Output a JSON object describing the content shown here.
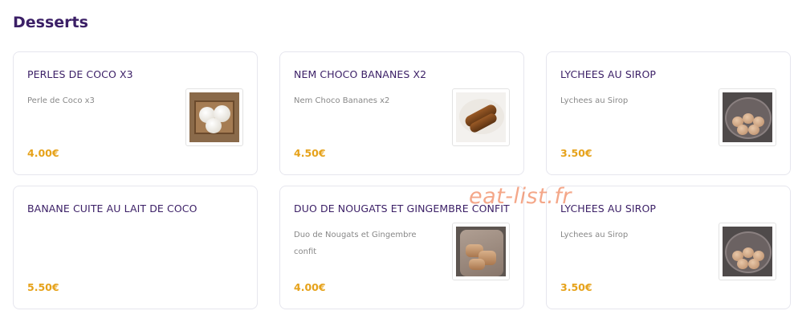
{
  "section": {
    "title": "Desserts"
  },
  "items": [
    {
      "name": "PERLES DE COCO X3",
      "description": "Perle de Coco x3",
      "price": "4.00€",
      "image": "coconut-pearls-image"
    },
    {
      "name": "NEM CHOCO BANANES X2",
      "description": "Nem Choco Bananes x2",
      "price": "4.50€",
      "image": "choco-banana-nem-image"
    },
    {
      "name": "LYCHEES AU SIROP",
      "description": "Lychees au Sirop",
      "price": "3.50€",
      "image": "lychees-image"
    },
    {
      "name": "BANANE CUITE AU LAIT DE COCO",
      "description": "",
      "price": "5.50€",
      "image": ""
    },
    {
      "name": "DUO DE NOUGATS ET GINGEMBRE CONFIT",
      "description": "Duo de Nougats et Gingembre confit",
      "price": "4.00€",
      "image": "nougats-image"
    },
    {
      "name": "LYCHEES AU SIROP",
      "description": "Lychees au Sirop",
      "price": "3.50€",
      "image": "lychees-image"
    }
  ],
  "watermark": "eat-list.fr",
  "colors": {
    "title": "#3b1f66",
    "price": "#e6a21a",
    "description": "#888888",
    "watermark": "#eb5f28"
  }
}
